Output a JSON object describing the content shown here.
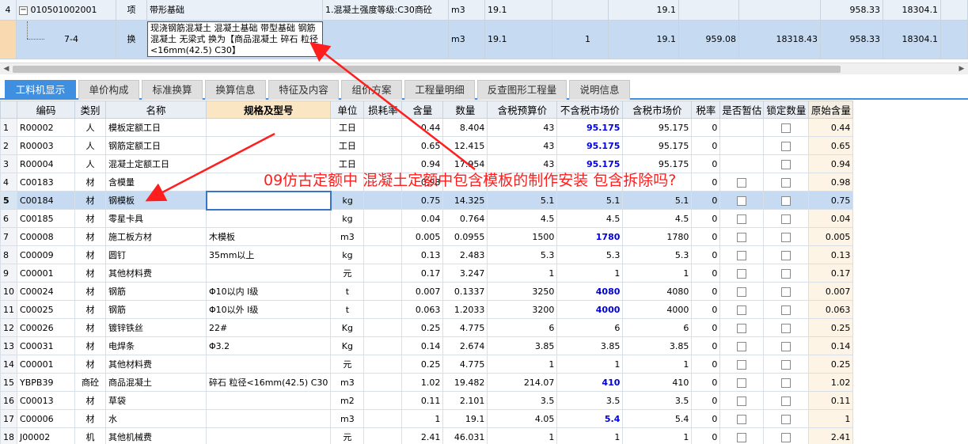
{
  "colors": {
    "accent": "#3f8fe0",
    "selection": "#c6dbf2",
    "highlight_price": "#0000e0",
    "annotation": "#ff1e1e"
  },
  "top_rows": [
    {
      "idx": "4",
      "toggle": "−",
      "code": "010501002001",
      "type": "项",
      "name": "带形基础",
      "feature": "1.混凝土强度等级:C30商砼",
      "unit": "m3",
      "qty": "19.1",
      "c_a": "",
      "c_b": "19.1",
      "c_c": "",
      "c_d": "",
      "c_e": "958.33",
      "c_f": "18304.1"
    },
    {
      "idx": "",
      "code": "7-4",
      "type": "换",
      "name": "现浇钢筋混凝土 混凝土基础 带型基础 钢筋混凝土 无梁式  换为【商品混凝土 碎石 粒径<16mm(42.5) C30】",
      "feature": "",
      "unit": "m3",
      "qty": "19.1",
      "c_a": "1",
      "c_b": "19.1",
      "c_c": "959.08",
      "c_d": "18318.43",
      "c_e": "958.33",
      "c_f": "18304.1"
    }
  ],
  "tabs": [
    {
      "label": "工料机显示",
      "active": true
    },
    {
      "label": "单价构成"
    },
    {
      "label": "标准换算"
    },
    {
      "label": "换算信息"
    },
    {
      "label": "特征及内容"
    },
    {
      "label": "组价方案"
    },
    {
      "label": "工程量明细"
    },
    {
      "label": "反查图形工程量"
    },
    {
      "label": "说明信息"
    }
  ],
  "headers": [
    "编码",
    "类别",
    "名称",
    "规格及型号",
    "单位",
    "损耗率",
    "含量",
    "数量",
    "含税预算价",
    "不含税市场价",
    "含税市场价",
    "税率",
    "是否暂估",
    "锁定数量",
    "原始含量"
  ],
  "rows": [
    {
      "n": "1",
      "code": "R00002",
      "cat": "人",
      "name": "模板定额工日",
      "spec": "",
      "unit": "工日",
      "loss": "",
      "content": "0.44",
      "qty": "8.404",
      "budget": "43",
      "market_ex": "95.175",
      "market_in": "95.175",
      "tax": "0",
      "est": false,
      "lock": true,
      "orig": "0.44"
    },
    {
      "n": "2",
      "code": "R00003",
      "cat": "人",
      "name": "钢筋定额工日",
      "spec": "",
      "unit": "工日",
      "loss": "",
      "content": "0.65",
      "qty": "12.415",
      "budget": "43",
      "market_ex": "95.175",
      "market_in": "95.175",
      "tax": "0",
      "est": false,
      "lock": true,
      "orig": "0.65"
    },
    {
      "n": "3",
      "code": "R00004",
      "cat": "人",
      "name": "混凝土定额工日",
      "spec": "",
      "unit": "工日",
      "loss": "",
      "content": "0.94",
      "qty": "17.954",
      "budget": "43",
      "market_ex": "95.175",
      "market_in": "95.175",
      "tax": "0",
      "est": false,
      "lock": true,
      "orig": "0.94"
    },
    {
      "n": "4",
      "code": "C00183",
      "cat": "材",
      "name": "含模量",
      "spec": "",
      "unit": "",
      "loss": "",
      "content": "0.98",
      "qty": "",
      "budget": "",
      "market_ex": "",
      "market_in": "",
      "tax": "0",
      "est": true,
      "lock": true,
      "orig": "0.98"
    },
    {
      "n": "5",
      "code": "C00184",
      "cat": "材",
      "name": "钢模板",
      "spec": "",
      "unit": "kg",
      "loss": "",
      "content": "0.75",
      "qty": "14.325",
      "budget": "5.1",
      "market_ex": "5.1",
      "market_in": "5.1",
      "tax": "0",
      "est": true,
      "lock": true,
      "orig": "0.75",
      "selected": true
    },
    {
      "n": "6",
      "code": "C00185",
      "cat": "材",
      "name": "零星卡具",
      "spec": "",
      "unit": "kg",
      "loss": "",
      "content": "0.04",
      "qty": "0.764",
      "budget": "4.5",
      "market_ex": "4.5",
      "market_in": "4.5",
      "tax": "0",
      "est": true,
      "lock": true,
      "orig": "0.04"
    },
    {
      "n": "7",
      "code": "C00008",
      "cat": "材",
      "name": "施工板方材",
      "spec": "木模板",
      "unit": "m3",
      "loss": "",
      "content": "0.005",
      "qty": "0.0955",
      "budget": "1500",
      "market_ex": "1780",
      "market_in": "1780",
      "tax": "0",
      "est": true,
      "lock": true,
      "orig": "0.005"
    },
    {
      "n": "8",
      "code": "C00009",
      "cat": "材",
      "name": "圆钉",
      "spec": "35mm以上",
      "unit": "kg",
      "loss": "",
      "content": "0.13",
      "qty": "2.483",
      "budget": "5.3",
      "market_ex": "5.3",
      "market_in": "5.3",
      "tax": "0",
      "est": true,
      "lock": true,
      "orig": "0.13"
    },
    {
      "n": "9",
      "code": "C00001",
      "cat": "材",
      "name": "其他材料费",
      "spec": "",
      "unit": "元",
      "loss": "",
      "content": "0.17",
      "qty": "3.247",
      "budget": "1",
      "market_ex": "1",
      "market_in": "1",
      "tax": "0",
      "est": true,
      "lock": true,
      "orig": "0.17"
    },
    {
      "n": "10",
      "code": "C00024",
      "cat": "材",
      "name": "钢筋",
      "spec": "Φ10以内 I级",
      "unit": "t",
      "loss": "",
      "content": "0.007",
      "qty": "0.1337",
      "budget": "3250",
      "market_ex": "4080",
      "market_in": "4080",
      "tax": "0",
      "est": true,
      "lock": true,
      "orig": "0.007"
    },
    {
      "n": "11",
      "code": "C00025",
      "cat": "材",
      "name": "钢筋",
      "spec": "Φ10以外 I级",
      "unit": "t",
      "loss": "",
      "content": "0.063",
      "qty": "1.2033",
      "budget": "3200",
      "market_ex": "4000",
      "market_in": "4000",
      "tax": "0",
      "est": true,
      "lock": true,
      "orig": "0.063"
    },
    {
      "n": "12",
      "code": "C00026",
      "cat": "材",
      "name": "镀锌铁丝",
      "spec": "22#",
      "unit": "Kg",
      "loss": "",
      "content": "0.25",
      "qty": "4.775",
      "budget": "6",
      "market_ex": "6",
      "market_in": "6",
      "tax": "0",
      "est": true,
      "lock": true,
      "orig": "0.25"
    },
    {
      "n": "13",
      "code": "C00031",
      "cat": "材",
      "name": "电焊条",
      "spec": "Φ3.2",
      "unit": "Kg",
      "loss": "",
      "content": "0.14",
      "qty": "2.674",
      "budget": "3.85",
      "market_ex": "3.85",
      "market_in": "3.85",
      "tax": "0",
      "est": true,
      "lock": true,
      "orig": "0.14"
    },
    {
      "n": "14",
      "code": "C00001",
      "cat": "材",
      "name": "其他材料费",
      "spec": "",
      "unit": "元",
      "loss": "",
      "content": "0.25",
      "qty": "4.775",
      "budget": "1",
      "market_ex": "1",
      "market_in": "1",
      "tax": "0",
      "est": true,
      "lock": true,
      "orig": "0.25"
    },
    {
      "n": "15",
      "code": "YBPB39",
      "cat": "商砼",
      "name": "商品混凝土",
      "spec": "碎石 粒径<16mm(42.5) C30",
      "unit": "m3",
      "loss": "",
      "content": "1.02",
      "qty": "19.482",
      "budget": "214.07",
      "market_ex": "410",
      "market_in": "410",
      "tax": "0",
      "est": true,
      "lock": true,
      "orig": "1.02"
    },
    {
      "n": "16",
      "code": "C00013",
      "cat": "材",
      "name": "草袋",
      "spec": "",
      "unit": "m2",
      "loss": "",
      "content": "0.11",
      "qty": "2.101",
      "budget": "3.5",
      "market_ex": "3.5",
      "market_in": "3.5",
      "tax": "0",
      "est": true,
      "lock": true,
      "orig": "0.11"
    },
    {
      "n": "17",
      "code": "C00006",
      "cat": "材",
      "name": "水",
      "spec": "",
      "unit": "m3",
      "loss": "",
      "content": "1",
      "qty": "19.1",
      "budget": "4.05",
      "market_ex": "5.4",
      "market_in": "5.4",
      "tax": "0",
      "est": true,
      "lock": true,
      "orig": "1"
    },
    {
      "n": "18",
      "code": "J00002",
      "cat": "机",
      "name": "其他机械费",
      "spec": "",
      "unit": "元",
      "loss": "",
      "content": "2.41",
      "qty": "46.031",
      "budget": "1",
      "market_ex": "1",
      "market_in": "1",
      "tax": "0",
      "est": true,
      "lock": true,
      "orig": "2.41"
    }
  ],
  "annotation": "09仿古定额中  混凝土定额中包含模板的制作安装  包含拆除吗?"
}
